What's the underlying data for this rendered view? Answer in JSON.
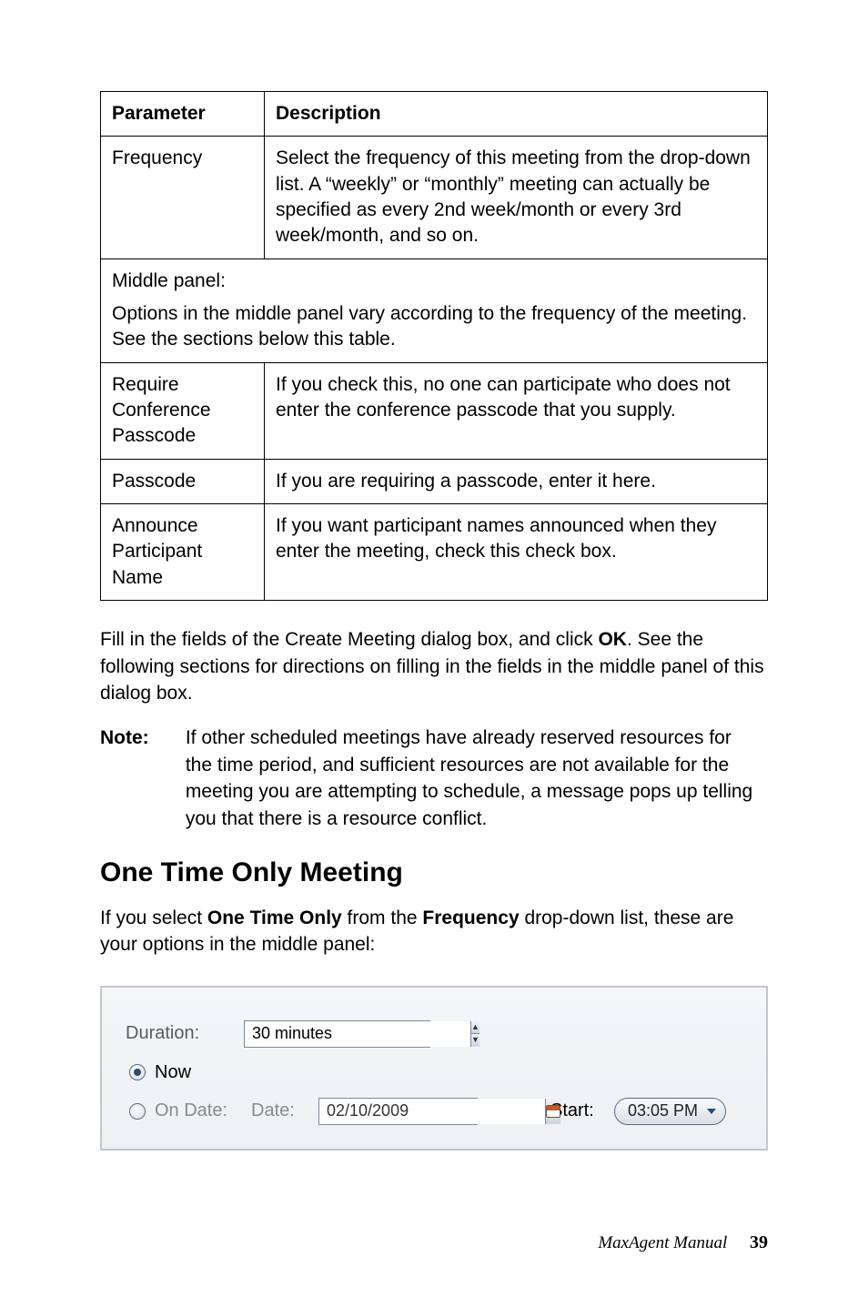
{
  "table": {
    "headers": {
      "param": "Parameter",
      "desc": "Description"
    },
    "rows": [
      {
        "param": "Frequency",
        "desc": "Select the frequency of this meeting from the drop-down list. A “weekly” or “monthly” meeting can actually be specified as every 2nd week/month or every 3rd week/month, and so on."
      }
    ],
    "middle_panel": {
      "title": "Middle panel:",
      "text": "Options in the middle panel vary according to the frequency of the meeting. See the sections below this table."
    },
    "rows2": [
      {
        "param": "Require Conference Passcode",
        "desc": "If you check this, no one can participate who does not enter the conference passcode that you supply."
      },
      {
        "param": "Passcode",
        "desc": "If you are requiring a passcode, enter it here."
      },
      {
        "param": "Announce Participant Name",
        "desc": "If you want participant names announced when they enter the meeting, check this check box."
      }
    ]
  },
  "paragraphs": {
    "p1_a": "Fill in the fields of the Create Meeting dialog box, and click ",
    "p1_ok": "OK",
    "p1_b": ". See the following sections for directions on filling in the fields in the middle panel of this dialog box.",
    "note_label": "Note:",
    "note_body": "If other scheduled meetings have already reserved resources for the time period, and sufficient resources are not available for the meeting you are attempting to schedule, a message pops up telling you that there is a resource conflict."
  },
  "heading": "One Time Only Meeting",
  "p2": {
    "a": "If you select ",
    "b": "One Time Only",
    "c": " from the ",
    "d": "Frequency",
    "e": " drop-down list, these are your options in the middle panel:"
  },
  "dialog": {
    "duration_label": "Duration:",
    "duration_value": "30 minutes",
    "now_label": "Now",
    "ondate_label": "On Date:",
    "date_label": "Date:",
    "date_value": "02/10/2009",
    "start_label": "Start:",
    "start_value": "03:05 PM"
  },
  "footer": {
    "title": "MaxAgent Manual",
    "page": "39"
  }
}
